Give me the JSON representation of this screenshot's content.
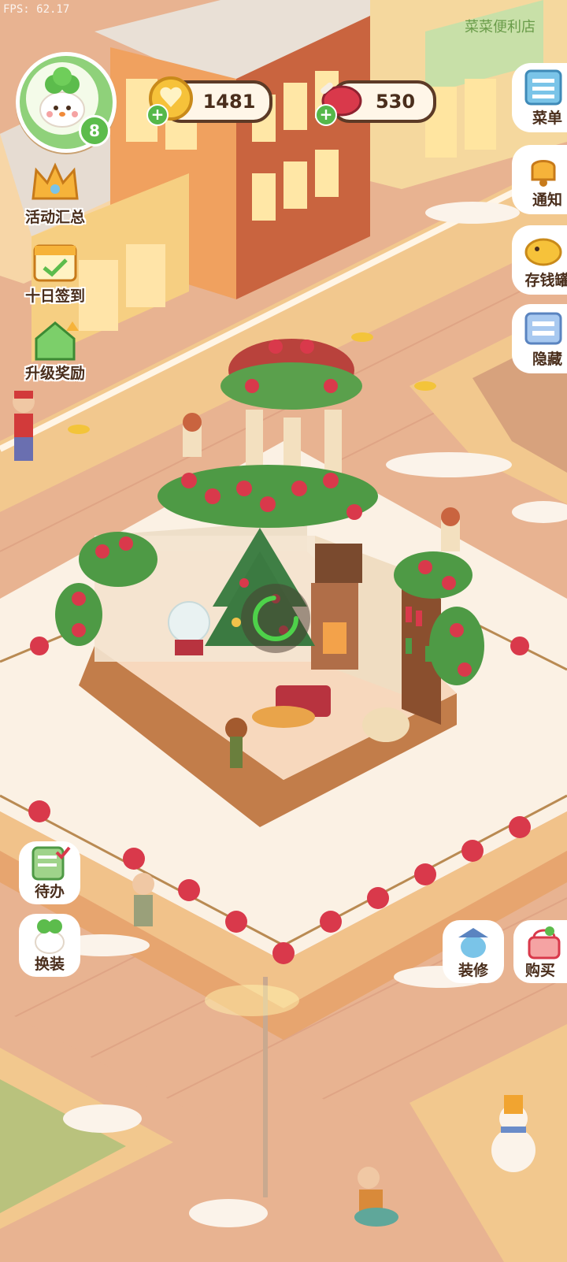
{
  "hud": {
    "fps": "FPS: 62.17",
    "player_level": "8",
    "coins": "1481",
    "food": "530"
  },
  "left_menu": {
    "events": "活动汇总",
    "checkin": "十日签到",
    "upgrade_rewards": "升级奖励"
  },
  "right_menu": {
    "menu": "菜单",
    "notice": "通知",
    "piggy_bank": "存钱罐",
    "hide": "隐藏"
  },
  "bottom_left": {
    "todo": "待办",
    "dress": "换装"
  },
  "bottom_right": {
    "decorate": "装修",
    "shop": "购买"
  },
  "scene": {
    "store_sign": "菜菜便利店"
  },
  "colors": {
    "road": "#e9b48f",
    "sidewalk": "#f2c98e",
    "snow": "#fbf3e8",
    "brick": "#c76b4a",
    "rose": "#d9394b",
    "leaf": "#4e9a45"
  }
}
